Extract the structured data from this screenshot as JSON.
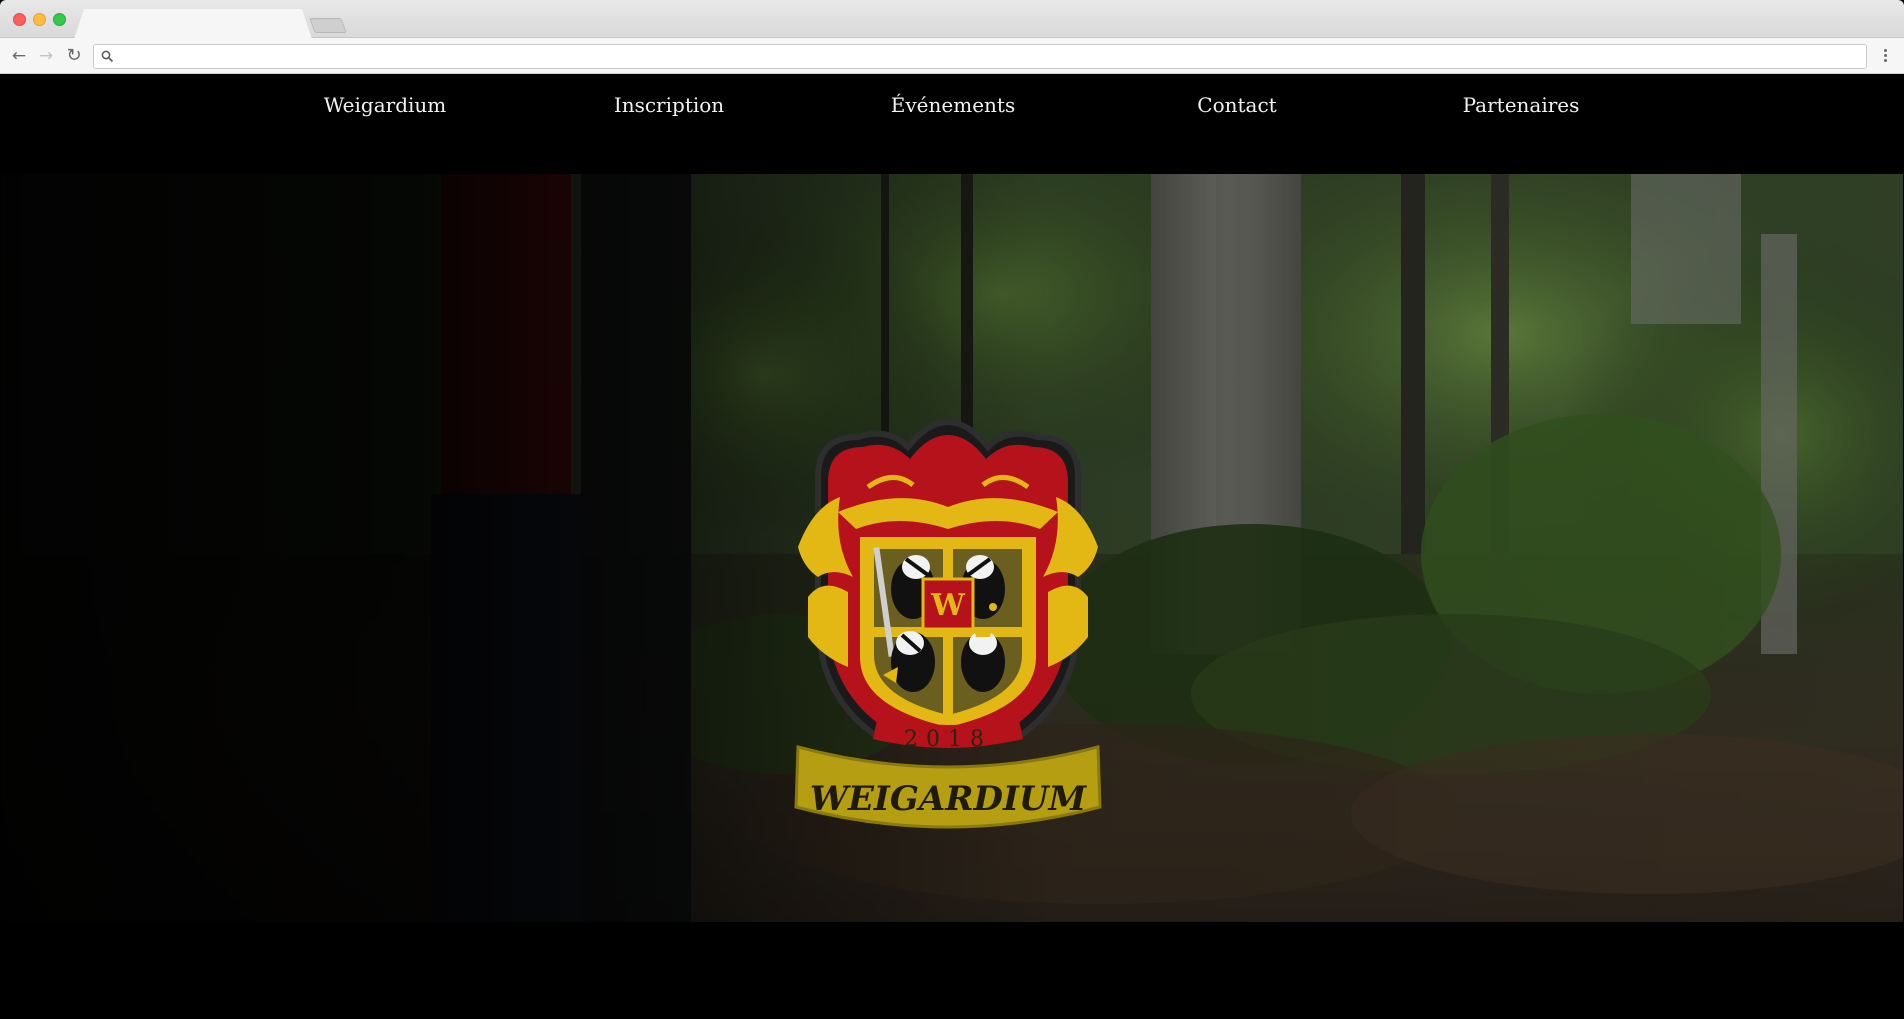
{
  "browser": {
    "tab_title": "",
    "address_placeholder": "",
    "address_value": ""
  },
  "nav": {
    "items": [
      {
        "label": "Weigardium"
      },
      {
        "label": "Inscription"
      },
      {
        "label": "Événements"
      },
      {
        "label": "Contact"
      },
      {
        "label": "Partenaires"
      }
    ]
  },
  "hero": {
    "logo": {
      "year": "2018",
      "name": "WEIGARDIUM",
      "monogram": "W"
    }
  },
  "colors": {
    "crest_red": "#b5121b",
    "crest_gold": "#e3b814",
    "banner_gold": "#b59e12",
    "nav_text": "#f2f2f2"
  }
}
